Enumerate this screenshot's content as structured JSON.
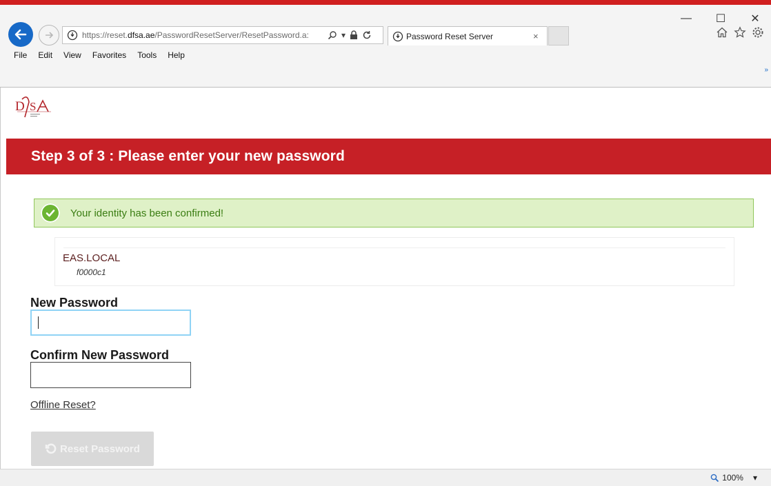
{
  "browser": {
    "url_prefix": "https://reset.",
    "url_domain": "dfsa.ae",
    "url_path": "/PasswordResetServer/ResetPassword.a:",
    "tab_title": "Password Reset Server",
    "tab_close": "×",
    "menu": [
      "File",
      "Edit",
      "View",
      "Favorites",
      "Tools",
      "Help"
    ],
    "window_buttons": {
      "minimize": "—",
      "maximize": "☐",
      "close": "✕"
    },
    "chevron": "»",
    "zoom": "100%"
  },
  "page": {
    "banner_title": "Step 3 of 3 : Please enter your new password",
    "success_message": "Your identity has been confirmed!",
    "account": {
      "domain": "EAS.LOCAL",
      "user": "f0000c1"
    },
    "new_password": {
      "label": "New Password",
      "value": ""
    },
    "confirm_password": {
      "label": "Confirm New Password",
      "value": ""
    },
    "offline_link": "Offline Reset?",
    "reset_button": "Reset Password"
  },
  "colors": {
    "banner": "#c62026",
    "success_bg": "#dff1c7",
    "success_border": "#8fc65a",
    "success_text": "#3a7d12",
    "back_button": "#1769c7"
  },
  "icons": [
    "back-arrow-icon",
    "forward-arrow-icon",
    "site-security-icon",
    "search-icon",
    "lock-icon",
    "refresh-icon",
    "home-icon",
    "favorites-star-icon",
    "settings-gear-icon",
    "check-icon",
    "reset-icon",
    "zoom-icon"
  ]
}
